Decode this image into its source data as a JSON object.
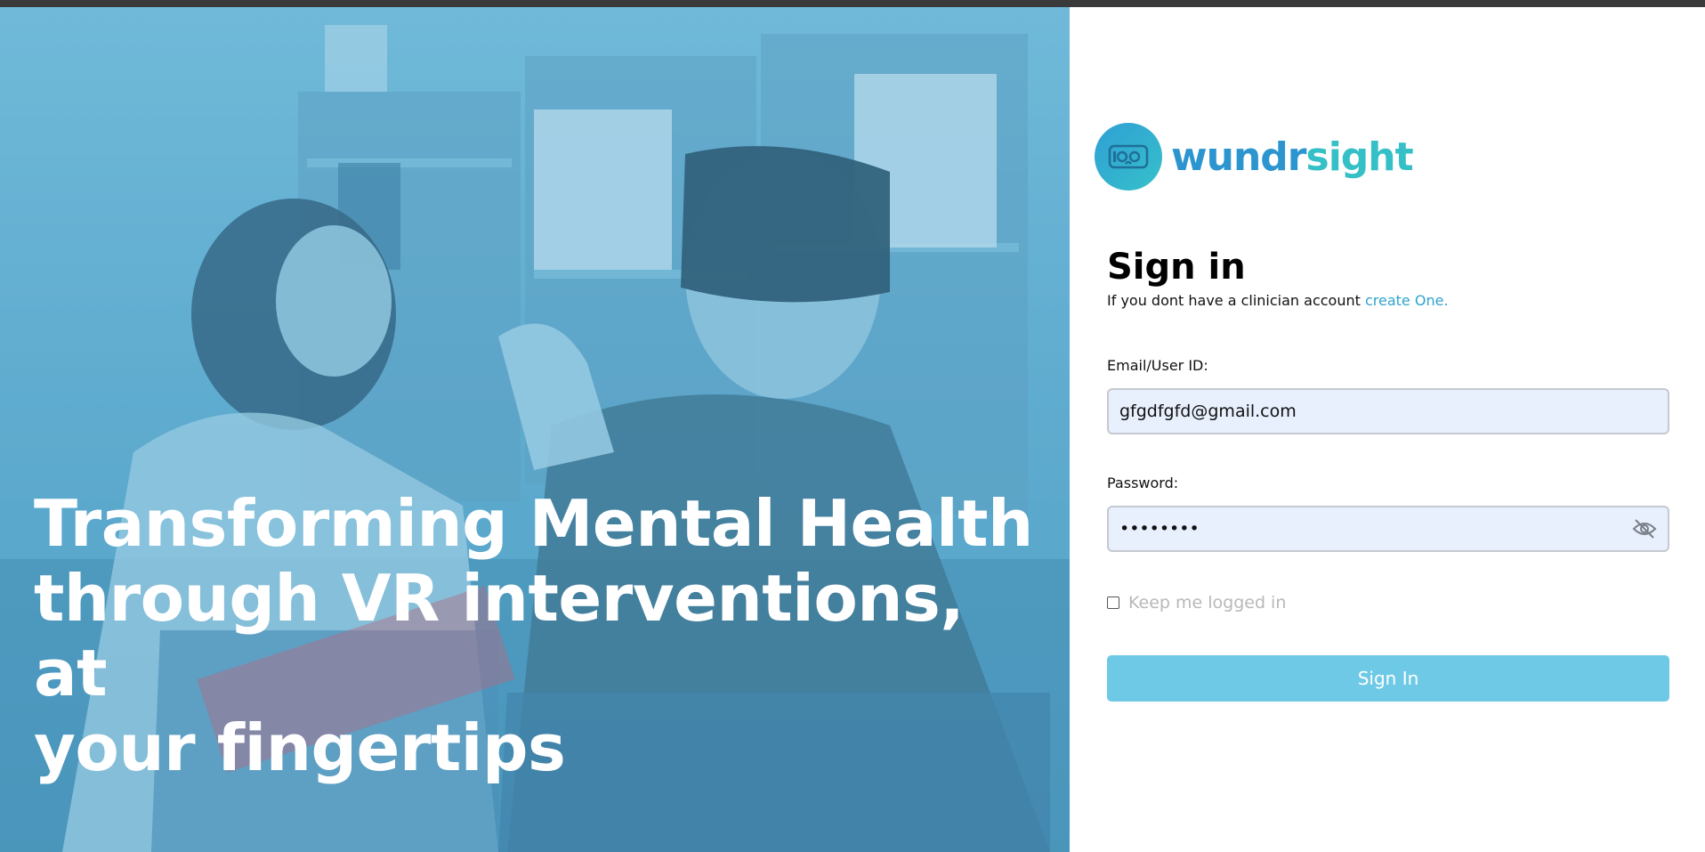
{
  "hero": {
    "headline_line1": "Transforming Mental Health",
    "headline_line2": "through VR interventions, at",
    "headline_line3": "your fingertips"
  },
  "brand": {
    "logo_icon": "vr-headset-icon",
    "name_part1": "wundr",
    "name_part2": "sight",
    "color_primary": "#2c95cf",
    "color_secondary": "#35bfc6"
  },
  "form": {
    "title": "Sign in",
    "subtitle_prefix": "If you dont have a clinician account ",
    "create_link": "create One.",
    "email_label": "Email/User ID:",
    "email_value": "gfgdfgfd@gmail.com",
    "password_label": "Password:",
    "password_value": "••••••••",
    "password_toggle_icon": "eye-off-icon",
    "keep_logged_in_label": "Keep me logged in",
    "keep_logged_in_checked": false,
    "submit_label": "Sign In",
    "submit_color": "#6ec9e6",
    "link_color": "#2ea3cc"
  }
}
